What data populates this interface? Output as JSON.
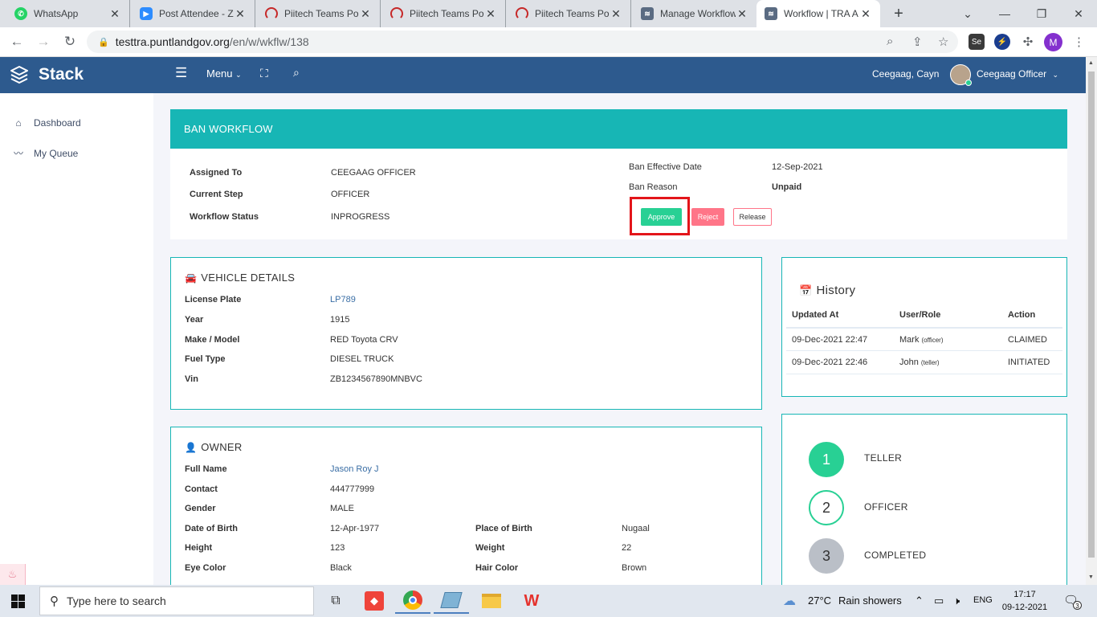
{
  "browser": {
    "tabs": [
      {
        "title": "WhatsApp",
        "icon": "whatsapp-icon"
      },
      {
        "title": "Post Attendee - Z",
        "icon": "zoom-icon"
      },
      {
        "title": "Piitech Teams Por",
        "icon": "piitech-icon"
      },
      {
        "title": "Piitech Teams Por",
        "icon": "piitech-icon"
      },
      {
        "title": "Piitech Teams Por",
        "icon": "piitech-icon"
      },
      {
        "title": "Manage Workflow",
        "icon": "stack-icon"
      },
      {
        "title": "Workflow | TRA A",
        "icon": "stack-icon"
      }
    ],
    "url_host": "testtra.puntlandgov.org",
    "url_path": "/en/w/wkflw/138",
    "profile_initial": "M",
    "extension_label": "Se"
  },
  "app": {
    "brand": "Stack",
    "menu_label": "Menu",
    "user_name": "Ceegaag, Cayn",
    "user_role": "Ceegaag Officer"
  },
  "sidebar": {
    "items": [
      {
        "label": "Dashboard",
        "icon": "home-icon"
      },
      {
        "label": "My Queue",
        "icon": "activity-icon"
      }
    ]
  },
  "workflow": {
    "title": "BAN WORKFLOW",
    "assigned_to_label": "Assigned To",
    "assigned_to": "CEEGAAG OFFICER",
    "current_step_label": "Current Step",
    "current_step": "OFFICER",
    "status_label": "Workflow Status",
    "status": "INPROGRESS",
    "ban_date_label": "Ban Effective Date",
    "ban_date": "12-Sep-2021",
    "ban_reason_label": "Ban Reason",
    "ban_reason": "Unpaid",
    "approve_label": "Approve",
    "reject_label": "Reject",
    "release_label": "Release"
  },
  "vehicle": {
    "title": "VEHICLE DETAILS",
    "fields": [
      {
        "label": "License Plate",
        "value": "LP789"
      },
      {
        "label": "Year",
        "value": "1915"
      },
      {
        "label": "Make / Model",
        "value": "RED Toyota CRV"
      },
      {
        "label": "Fuel Type",
        "value": "DIESEL TRUCK"
      },
      {
        "label": "Vin",
        "value": "ZB1234567890MNBVC"
      }
    ]
  },
  "owner": {
    "title": "OWNER",
    "full_name_label": "Full Name",
    "full_name": "Jason Roy J",
    "contact_label": "Contact",
    "contact": "444777999",
    "gender_label": "Gender",
    "gender": "MALE",
    "dob_label": "Date of Birth",
    "dob": "12-Apr-1977",
    "pob_label": "Place of Birth",
    "pob": "Nugaal",
    "height_label": "Height",
    "height": "123",
    "weight_label": "Weight",
    "weight": "22",
    "eye_label": "Eye Color",
    "eye": "Black",
    "hair_label": "Hair Color",
    "hair": "Brown"
  },
  "history": {
    "title": "History",
    "columns": [
      "Updated At",
      "User/Role",
      "Action"
    ],
    "rows": [
      {
        "updated_at": "09-Dec-2021 22:47",
        "user": "Mark",
        "role": "(officer)",
        "action": "CLAIMED"
      },
      {
        "updated_at": "09-Dec-2021 22:46",
        "user": "John",
        "role": "(teller)",
        "action": "INITIATED"
      }
    ]
  },
  "steps": [
    {
      "number": "1",
      "label": "TELLER",
      "state": "done"
    },
    {
      "number": "2",
      "label": "OFFICER",
      "state": "current"
    },
    {
      "number": "3",
      "label": "COMPLETED",
      "state": "pending"
    }
  ],
  "taskbar": {
    "search_placeholder": "Type here to search",
    "temperature": "27°C",
    "weather": "Rain showers",
    "language": "ENG",
    "time": "17:17",
    "date": "09-12-2021",
    "notification_count": "3"
  },
  "colors": {
    "header": "#2d5a8e",
    "teal": "#17b6b5",
    "success": "#28d094",
    "danger": "#ff7588",
    "highlight": "#e3151a"
  }
}
